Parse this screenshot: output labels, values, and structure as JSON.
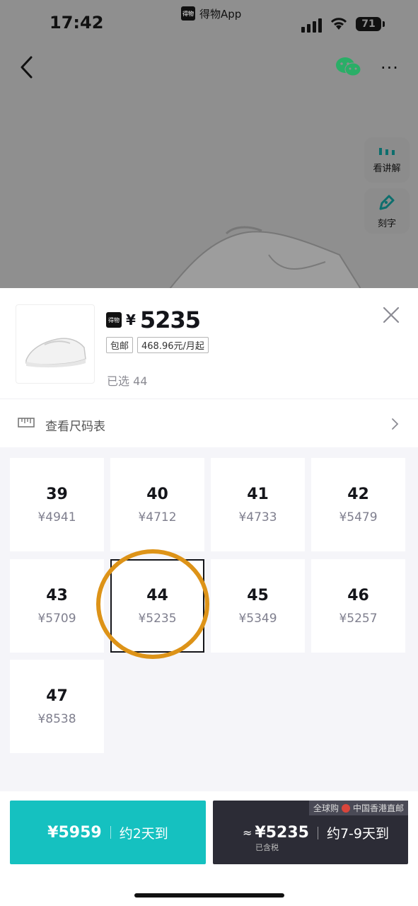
{
  "status_bar": {
    "time": "17:42",
    "app_name": "得物App",
    "battery": "71"
  },
  "header": {
    "wechat_icon": "wechat-icon",
    "more_label": "···"
  },
  "side_buttons": [
    {
      "icon": "audio-bars-icon",
      "label": "看讲解"
    },
    {
      "icon": "engrave-pen-icon",
      "label": "刻字"
    }
  ],
  "product": {
    "logo_text": "得物",
    "currency": "¥",
    "price": "5235",
    "tags": [
      "包邮",
      "468.96元/月起"
    ],
    "selected": "已选 44"
  },
  "size_chart": {
    "label": "查看尺码表"
  },
  "sizes": [
    {
      "size": "39",
      "price": "¥4941"
    },
    {
      "size": "40",
      "price": "¥4712"
    },
    {
      "size": "41",
      "price": "¥4733"
    },
    {
      "size": "42",
      "price": "¥5479"
    },
    {
      "size": "43",
      "price": "¥5709"
    },
    {
      "size": "44",
      "price": "¥5235",
      "selected": true
    },
    {
      "size": "45",
      "price": "¥5349"
    },
    {
      "size": "46",
      "price": "¥5257"
    },
    {
      "size": "47",
      "price": "¥8538"
    }
  ],
  "buy_left": {
    "price": "¥5959",
    "delivery": "约2天到"
  },
  "buy_right": {
    "badge_left": "全球购",
    "badge_right": "中国香港直邮",
    "approx": "≈",
    "price": "¥5235",
    "delivery": "约7-9天到",
    "tax_note": "已含税"
  },
  "colors": {
    "teal": "#15c1c0",
    "dark": "#2c2c36",
    "annotation": "#dd9318"
  }
}
